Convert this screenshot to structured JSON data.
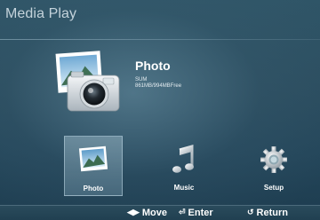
{
  "app": {
    "title": "Media Play"
  },
  "info": {
    "title": "Photo",
    "device": "SUM",
    "capacity": "861MB/994MBFree"
  },
  "menu": {
    "items": [
      {
        "label": "Photo",
        "icon": "photo-icon",
        "selected": true
      },
      {
        "label": "Music",
        "icon": "music-note-icon",
        "selected": false
      },
      {
        "label": "Setup",
        "icon": "gear-icon",
        "selected": false
      }
    ]
  },
  "hints": {
    "move": "Move",
    "enter": "Enter",
    "return": "Return",
    "move_glyph": "◀▶",
    "enter_glyph": "⏎",
    "return_glyph": "↺"
  },
  "colors": {
    "background": "#2b4d5f",
    "title_text": "#c4d3db",
    "accent": "#ffffff"
  }
}
